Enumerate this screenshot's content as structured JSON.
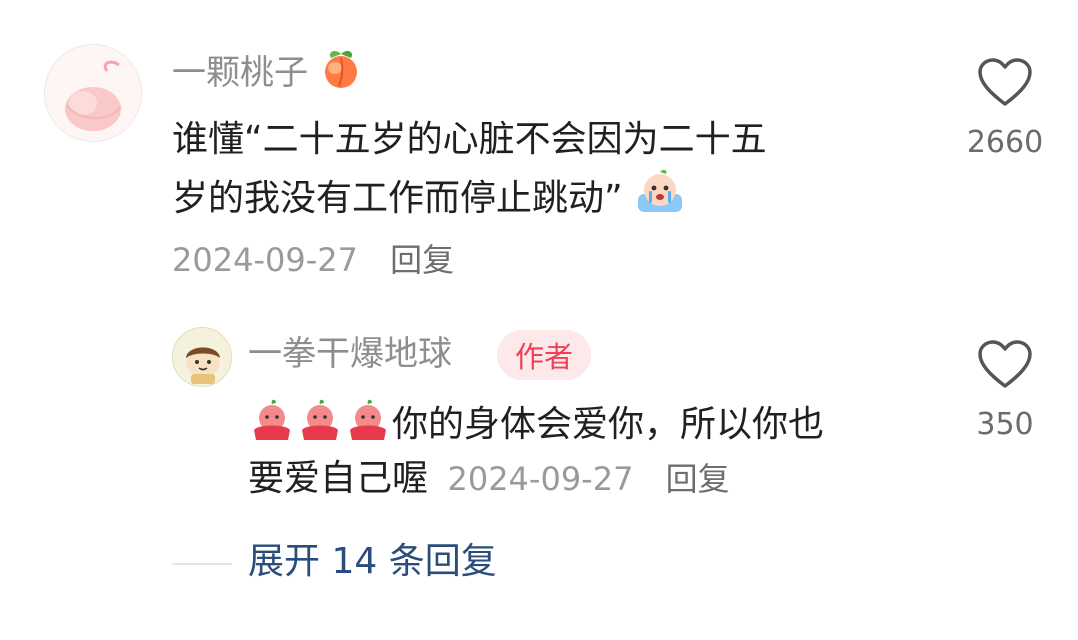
{
  "comment": {
    "username": "一颗桃子",
    "username_emoji": "peach-emoji",
    "text_line1": "谁懂“二十五岁的心脏不会因为二十五",
    "text_line2": "岁的我没有工作而停止跳动”",
    "text_emoji": "crying-emoji",
    "date": "2024-09-27",
    "reply_label": "回复",
    "like_count": "2660"
  },
  "reply": {
    "username": "一拳干爆地球",
    "badge": "作者",
    "text_emoji": "peach-character-emoji",
    "text_line1": "你的身体会爱你，所以你也",
    "text_line2": "要爱自己喔",
    "date": "2024-09-27",
    "reply_label": "回复",
    "like_count": "350"
  },
  "expand_replies": "展开 14 条回复",
  "colors": {
    "username": "#8e8e8e",
    "badge_text": "#f04055",
    "badge_bg": "#fde9ea",
    "expand_link": "#2a4d7c"
  }
}
